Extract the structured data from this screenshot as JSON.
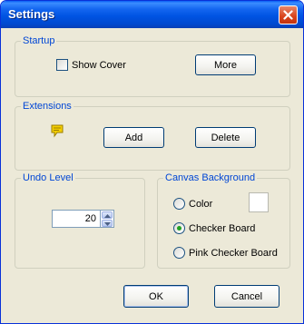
{
  "window": {
    "title": "Settings",
    "close_icon": "close-icon"
  },
  "startup": {
    "group_label": "Startup",
    "show_cover_label": "Show Cover",
    "show_cover_checked": false,
    "more_label": "More"
  },
  "extensions": {
    "group_label": "Extensions",
    "icon": "speech-bubble-icon",
    "add_label": "Add",
    "delete_label": "Delete"
  },
  "undo": {
    "group_label": "Undo Level",
    "value": "20"
  },
  "canvas": {
    "group_label": "Canvas Background",
    "options": [
      {
        "label": "Color",
        "checked": false
      },
      {
        "label": "Checker Board",
        "checked": true
      },
      {
        "label": "Pink Checker Board",
        "checked": false
      }
    ],
    "color_swatch": "#ffffff"
  },
  "footer": {
    "ok_label": "OK",
    "cancel_label": "Cancel"
  },
  "colors": {
    "title_bar": "#0054e3",
    "dialog_bg": "#ece9d8",
    "group_label": "#0046d5",
    "radio_checked": "#21a121"
  }
}
